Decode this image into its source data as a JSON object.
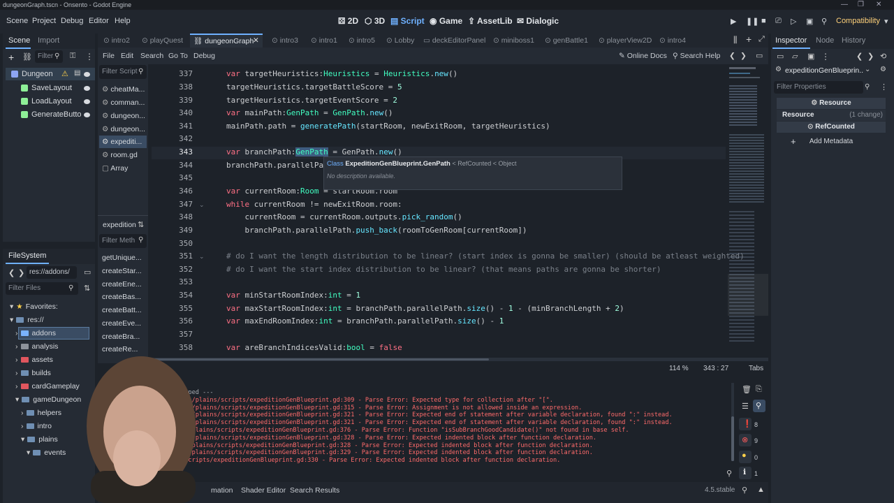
{
  "window": {
    "title": "dungeonGraph.tscn - Onsento - Godot Engine"
  },
  "menu": {
    "items": [
      "Scene",
      "Project",
      "Debug",
      "Editor",
      "Help"
    ]
  },
  "workspaces": [
    "2D",
    "3D",
    "Script",
    "Game",
    "AssetLib",
    "Dialogic"
  ],
  "renderer": "Compatibility",
  "scene_dock": {
    "tabs": [
      "Scene",
      "Import"
    ],
    "filter_placeholder": "Filter",
    "nodes": [
      "Dungeon",
      "SaveLayout",
      "LoadLayout",
      "GenerateButto"
    ]
  },
  "filesystem": {
    "tab": "FileSystem",
    "path": "res://addons/",
    "filter_placeholder": "Filter Files",
    "items": [
      "Favorites:",
      "res://",
      "addons",
      "analysis",
      "assets",
      "builds",
      "cardGameplay",
      "gameDungeon",
      "helpers",
      "intro",
      "plains",
      "events"
    ]
  },
  "script_list": {
    "filter_placeholder": "Filter Script",
    "items": [
      "cheatMa...",
      "comman...",
      "dungeon...",
      "dungeon...",
      "expediti...",
      "room.gd",
      "Array"
    ],
    "current": "expedition",
    "methods_filter_placeholder": "Filter Meth",
    "methods": [
      "getUnique...",
      "createStar...",
      "createEne...",
      "createBas...",
      "createBatt...",
      "createEve...",
      "createBra...",
      "createRe..."
    ]
  },
  "editor_tabs": [
    "intro2",
    "playQuest",
    "dungeonGraph",
    "intro3",
    "intro1",
    "intro5",
    "Lobby",
    "deckEditorPanel",
    "miniboss1",
    "genBattle1",
    "playerView2D",
    "intro4"
  ],
  "script_menu": [
    "File",
    "Edit",
    "Search",
    "Go To",
    "Debug"
  ],
  "script_tools": {
    "docs": "Online Docs",
    "search_help": "Search Help"
  },
  "code": {
    "line_numbers": [
      "337",
      "338",
      "339",
      "340",
      "341",
      "342",
      "343",
      "344",
      "345",
      "346",
      "347",
      "348",
      "349",
      "350",
      "351",
      "352",
      "353",
      "354",
      "355",
      "356",
      "357",
      "358"
    ],
    "tooltip": {
      "prefix": "Class",
      "name": "ExpeditionGenBlueprint.GenPath",
      "inherits": "< RefCounted < Object",
      "desc": "No description available."
    },
    "zoom": "114 %",
    "cursor": "343 :   27",
    "indent": "Tabs"
  },
  "output": {
    "header": "ess stopped ---",
    "lines": [
      "meDungeon/plains/scripts/expeditionGenBlueprint.gd:309 - Parse Error: Expected type for collection after \"[\".",
      "meDungeon/plains/scripts/expeditionGenBlueprint.gd:315 - Parse Error: Assignment is not allowed inside an expression.",
      "meDungeon/plains/scripts/expeditionGenBlueprint.gd:321 - Parse Error: Expected end of statement after variable declaration, found \":\" instead.",
      "meDungeon/plains/scripts/expeditionGenBlueprint.gd:321 - Parse Error: Expected end of statement after variable declaration, found \":\" instead.",
      "eDungeon/plains/scripts/expeditionGenBlueprint.gd:376 - Parse Error: Function \"isSubBranchGoodCandidate()\" not found in base self.",
      "meDungeon/plains/scripts/expeditionGenBlueprint.gd:328 - Parse Error: Expected indented block after function declaration.",
      "eDungeon/plains/scripts/expeditionGenBlueprint.gd:328 - Parse Error: Expected indented block after function declaration.",
      "eDungeon/plains/scripts/expeditionGenBlueprint.gd:329 - Parse Error: Expected indented block after function declaration.",
      "plains/scripts/expeditionGenBlueprint.gd:330 - Parse Error: Expected indented block after function declaration."
    ],
    "counts": {
      "errors_all": "8",
      "errors": "9",
      "warnings": "0",
      "messages": "1"
    }
  },
  "bottom_tabs": [
    "mation",
    "Shader Editor",
    "Search Results"
  ],
  "version": "4.5.stable",
  "inspector": {
    "tabs": [
      "Inspector",
      "Node",
      "History"
    ],
    "resource_name": "expeditionGenBlueprin...",
    "filter_placeholder": "Filter Properties",
    "section": "Resource",
    "row_label": "Resource",
    "row_value": "(1 change)",
    "sub": "RefCounted",
    "add_meta": "Add Metadata"
  },
  "colors": {
    "accent": "#6fb1ff",
    "keyword": "#ff7085",
    "type": "#42ffc2",
    "func": "#66e6ff",
    "error": "#ff6b6b"
  }
}
